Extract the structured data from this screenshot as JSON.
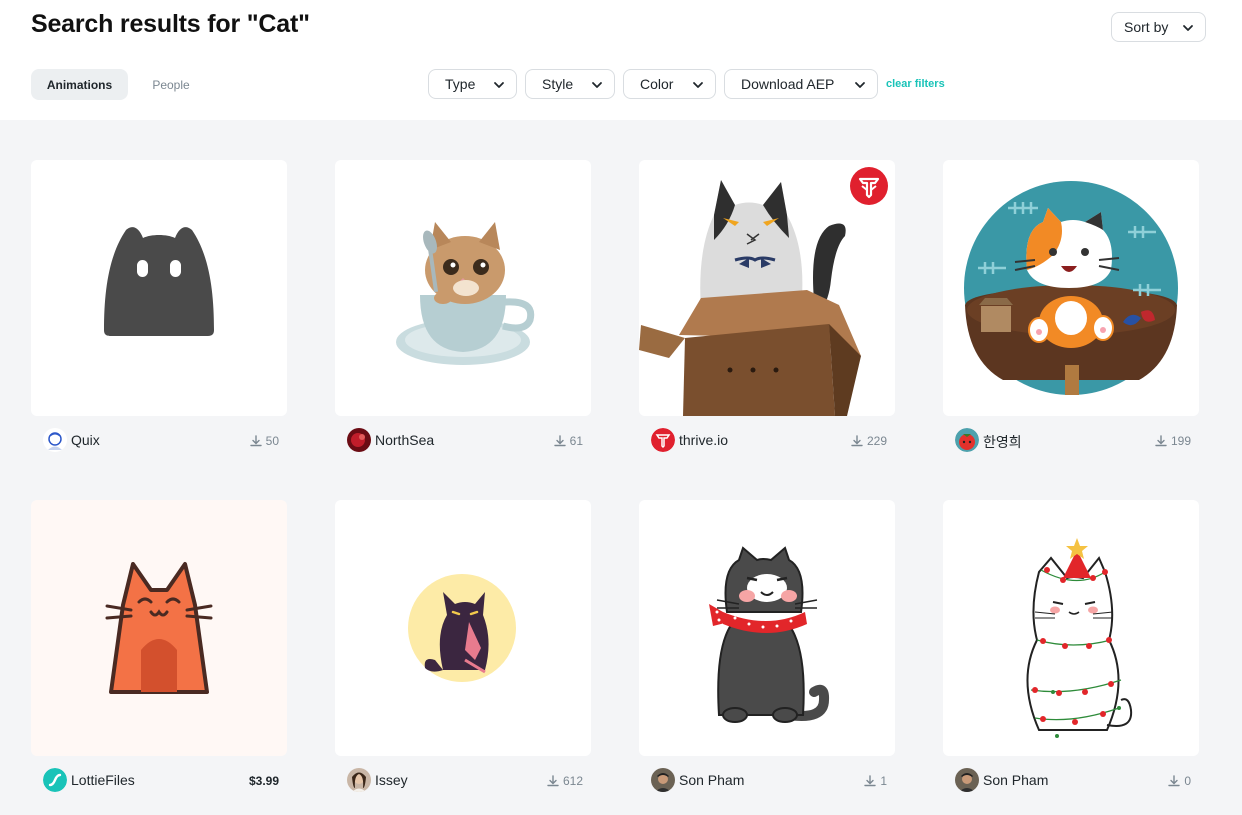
{
  "header": {
    "title": "Search results for \"Cat\"",
    "sort_label": "Sort by"
  },
  "tabs": [
    {
      "label": "Animations",
      "active": true
    },
    {
      "label": "People",
      "active": false
    }
  ],
  "filters": [
    {
      "label": "Type"
    },
    {
      "label": "Style"
    },
    {
      "label": "Color"
    },
    {
      "label": "Download AEP"
    }
  ],
  "clear_filters": "clear filters",
  "colors": {
    "accent": "#19c3b8",
    "grid_background": "#f4f5f7",
    "badge_red": "#e0202e"
  },
  "results": [
    {
      "author": "Quix",
      "downloads": "50",
      "preview": "dark-gray-cat-head-icon"
    },
    {
      "author": "NorthSea",
      "downloads": "61",
      "preview": "kitten-in-teacup-icon"
    },
    {
      "author": "thrive.io",
      "downloads": "229",
      "preview": "cat-in-cardboard-box-icon",
      "badge": "thrive-logo-badge"
    },
    {
      "author": "한영희",
      "downloads": "199",
      "preview": "orange-calico-cat-icon"
    },
    {
      "author": "LottieFiles",
      "price": "$3.99",
      "preview": "orange-cat-house-icon"
    },
    {
      "author": "Issey",
      "downloads": "612",
      "preview": "purple-cat-in-yellow-circle-icon"
    },
    {
      "author": "Son Pham",
      "downloads": "1",
      "preview": "gray-cat-red-scarf-icon"
    },
    {
      "author": "Son Pham",
      "downloads": "0",
      "preview": "christmas-cat-lights-icon"
    }
  ]
}
